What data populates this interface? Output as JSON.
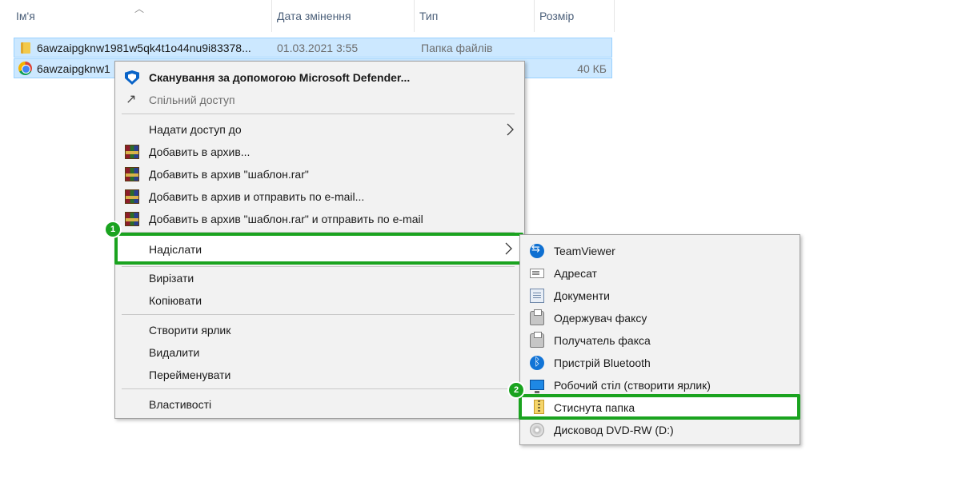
{
  "columns": {
    "name": "Ім'я",
    "date": "Дата змінення",
    "type": "Тип",
    "size": "Розмір"
  },
  "files": [
    {
      "name": "6awzaipgknw1981w5qk4t1o44nu9i83378...",
      "date": "01.03.2021 3:55",
      "type": "Папка файлів",
      "size": "",
      "icon": "folder-icon"
    },
    {
      "name": "6awzaipgknw1",
      "date": "",
      "type": "",
      "size": "40 КБ",
      "icon": "chrome-icon"
    }
  ],
  "context_menu": {
    "items": [
      {
        "label": "Сканування за допомогою Microsoft Defender...",
        "icon": "defender-shield-icon",
        "bold": true
      },
      {
        "label": "Спільний доступ",
        "icon": "share-icon",
        "disabled": true
      },
      {
        "label": "Надати доступ до",
        "submenu": true
      },
      {
        "label": "Добавить в архив...",
        "icon": "winrar-icon"
      },
      {
        "label": "Добавить в архив \"шаблон.rar\"",
        "icon": "winrar-icon"
      },
      {
        "label": "Добавить в архив и отправить по e-mail...",
        "icon": "winrar-icon"
      },
      {
        "label": "Добавить в архив \"шаблон.rar\" и отправить по e-mail",
        "icon": "winrar-icon"
      },
      {
        "label": "Надіслати",
        "submenu": true,
        "highlighted": true
      },
      {
        "label": "Вирізати"
      },
      {
        "label": "Копіювати"
      },
      {
        "label": "Створити ярлик"
      },
      {
        "label": "Видалити"
      },
      {
        "label": "Перейменувати"
      },
      {
        "label": "Властивості"
      }
    ]
  },
  "send_to_menu": {
    "items": [
      {
        "label": "TeamViewer",
        "icon": "teamviewer-icon"
      },
      {
        "label": "Адресат",
        "icon": "mail-recipient-icon"
      },
      {
        "label": "Документи",
        "icon": "documents-icon"
      },
      {
        "label": "Одержувач факсу",
        "icon": "fax-icon"
      },
      {
        "label": "Получатель факса",
        "icon": "fax-icon"
      },
      {
        "label": "Пристрій Bluetooth",
        "icon": "bluetooth-icon"
      },
      {
        "label": "Робочий стіл (створити ярлик)",
        "icon": "desktop-icon"
      },
      {
        "label": "Стиснута папка",
        "icon": "zip-folder-icon",
        "highlighted": true
      },
      {
        "label": "Дисковод DVD-RW (D:)",
        "icon": "dvd-drive-icon"
      }
    ]
  },
  "badges": {
    "step1": "1",
    "step2": "2"
  },
  "colors": {
    "highlight": "#1aa31f",
    "selection": "#cce8ff",
    "menu_bg": "#f2f2f2"
  }
}
